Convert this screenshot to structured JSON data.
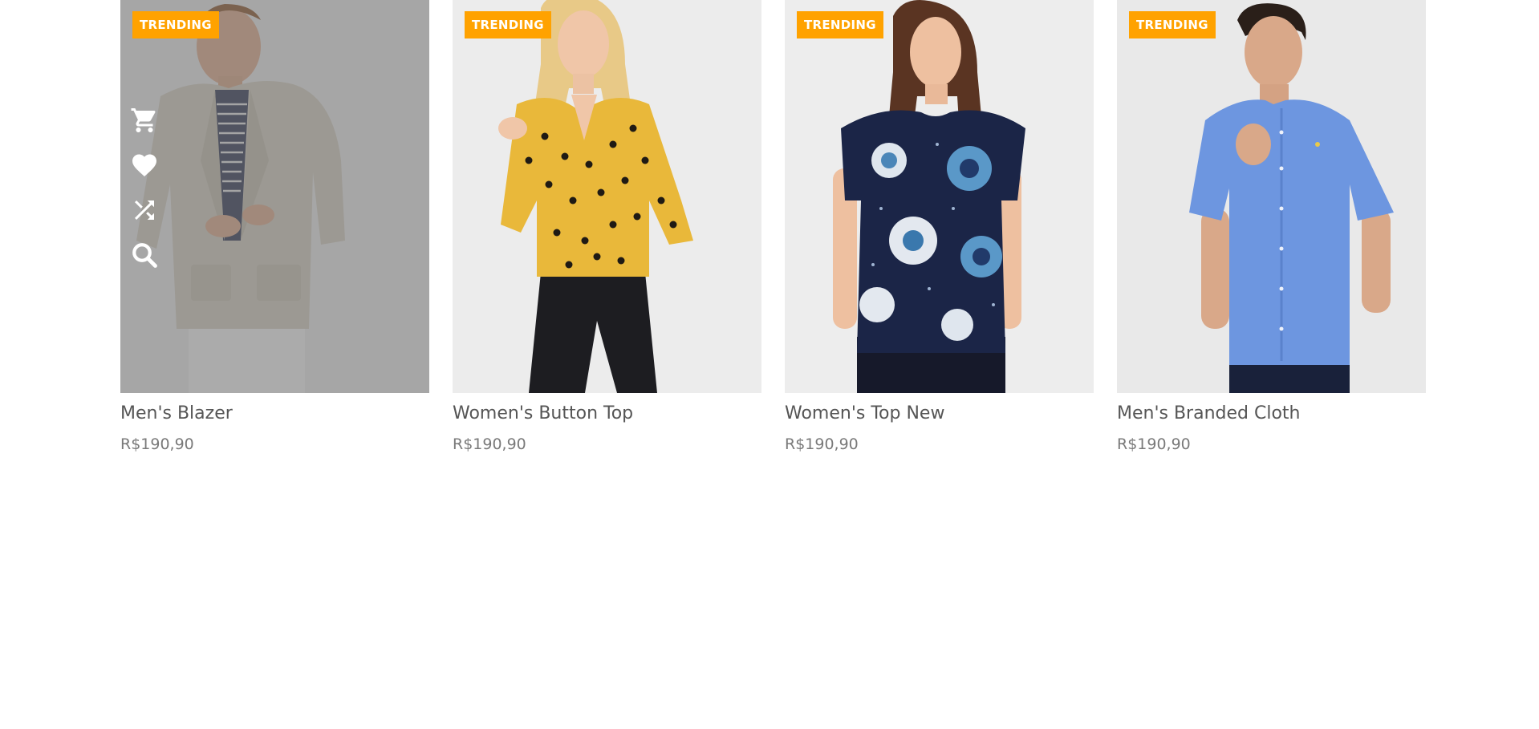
{
  "products": [
    {
      "badge": "TRENDING",
      "title": "Men's Blazer",
      "price": "R$190,90",
      "image_icon": "man-in-blazer-photo",
      "hovered": true
    },
    {
      "badge": "TRENDING",
      "title": "Women's Button Top",
      "price": "R$190,90",
      "image_icon": "woman-in-yellow-polka-top-photo",
      "hovered": false
    },
    {
      "badge": "TRENDING",
      "title": "Women's Top New",
      "price": "R$190,90",
      "image_icon": "woman-in-floral-navy-top-photo",
      "hovered": false
    },
    {
      "badge": "TRENDING",
      "title": "Men's Branded Cloth",
      "price": "R$190,90",
      "image_icon": "man-in-blue-shirt-photo",
      "hovered": false
    }
  ],
  "hover_actions": [
    "cart-icon",
    "heart-icon",
    "shuffle-icon",
    "search-icon"
  ],
  "colors": {
    "badge": "#ffa200",
    "title_text": "#555555",
    "price_text": "#7a7a7a"
  }
}
